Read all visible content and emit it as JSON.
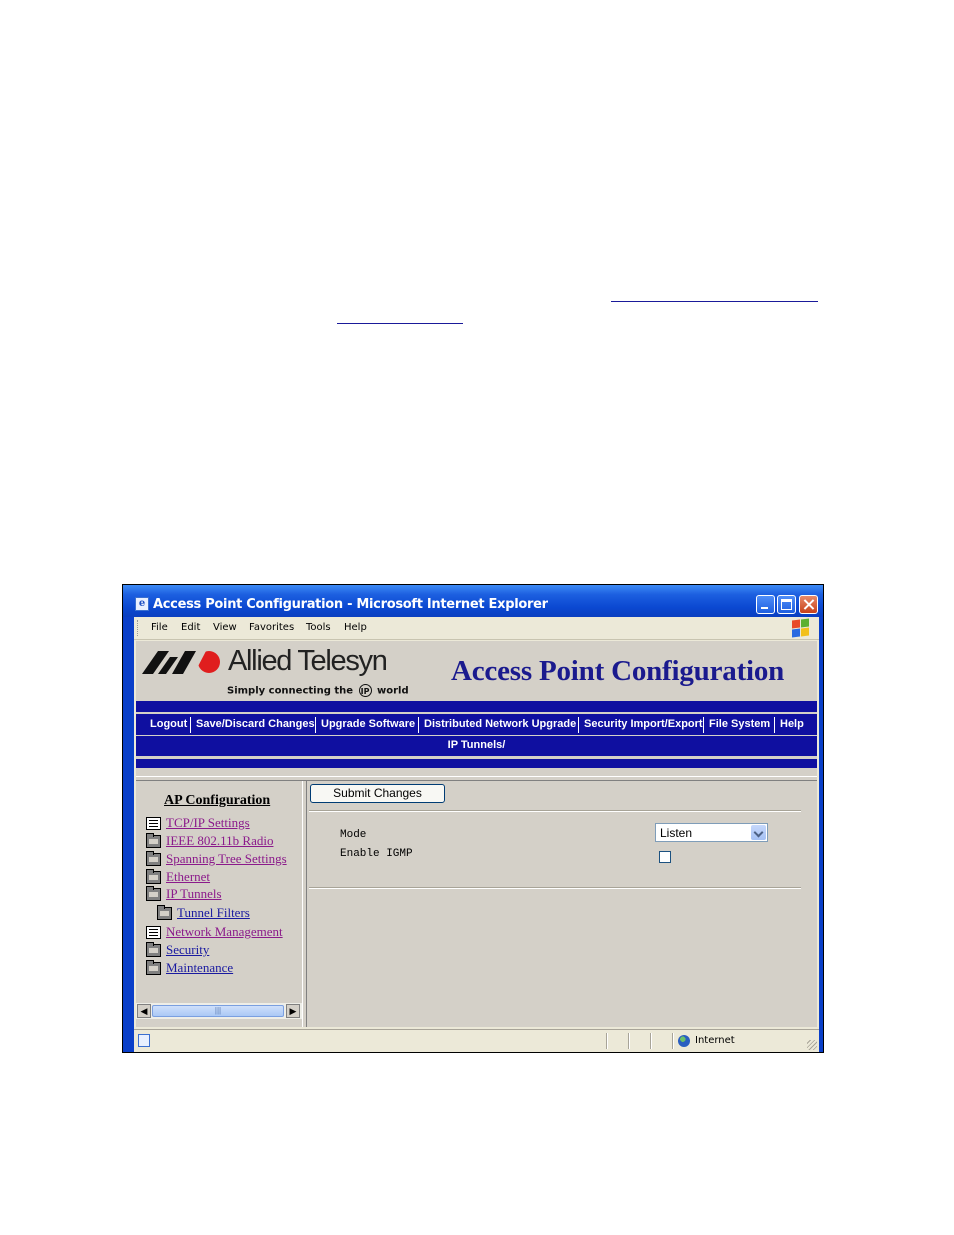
{
  "window": {
    "title": "Access Point Configuration - Microsoft Internet Explorer"
  },
  "menubar": {
    "items": [
      "File",
      "Edit",
      "View",
      "Favorites",
      "Tools",
      "Help"
    ]
  },
  "header": {
    "brand_name": "Allied Telesyn",
    "tagline_before": "Simply connecting the",
    "tagline_badge": "IP",
    "tagline_after": "world",
    "app_title": "Access Point Configuration"
  },
  "nav": {
    "links": [
      "Logout",
      "Save/Discard Changes",
      "Upgrade Software",
      "Distributed Network Upgrade",
      "Security Import/Export",
      "File System",
      "Help"
    ],
    "breadcrumb": "IP Tunnels/"
  },
  "tree": {
    "title": "AP Configuration",
    "items": [
      {
        "label": "TCP/IP Settings",
        "icon": "document-icon",
        "state": "visited"
      },
      {
        "label": "IEEE 802.11b Radio",
        "icon": "folder-icon",
        "state": "visited"
      },
      {
        "label": "Spanning Tree Settings",
        "icon": "folder-icon",
        "state": "visited"
      },
      {
        "label": "Ethernet",
        "icon": "folder-icon",
        "state": "visited"
      },
      {
        "label": "IP Tunnels",
        "icon": "folder-open-icon",
        "state": "visited"
      },
      {
        "label": "Tunnel Filters",
        "icon": "folder-icon",
        "state": "link"
      },
      {
        "label": "Network Management",
        "icon": "document-icon",
        "state": "visited"
      },
      {
        "label": "Security",
        "icon": "folder-icon",
        "state": "link"
      },
      {
        "label": "Maintenance",
        "icon": "folder-icon",
        "state": "link"
      }
    ]
  },
  "form": {
    "submit_label": "Submit Changes",
    "mode_label": "Mode",
    "mode_value": "Listen",
    "igmp_label": "Enable IGMP",
    "igmp_checked": false
  },
  "statusbar": {
    "zone": "Internet"
  },
  "colors": {
    "nav_blue": "#0f0fa0",
    "title_blue": "#1a1a8e",
    "visited_link": "#8b1a8b",
    "link": "#1a1aa0"
  }
}
